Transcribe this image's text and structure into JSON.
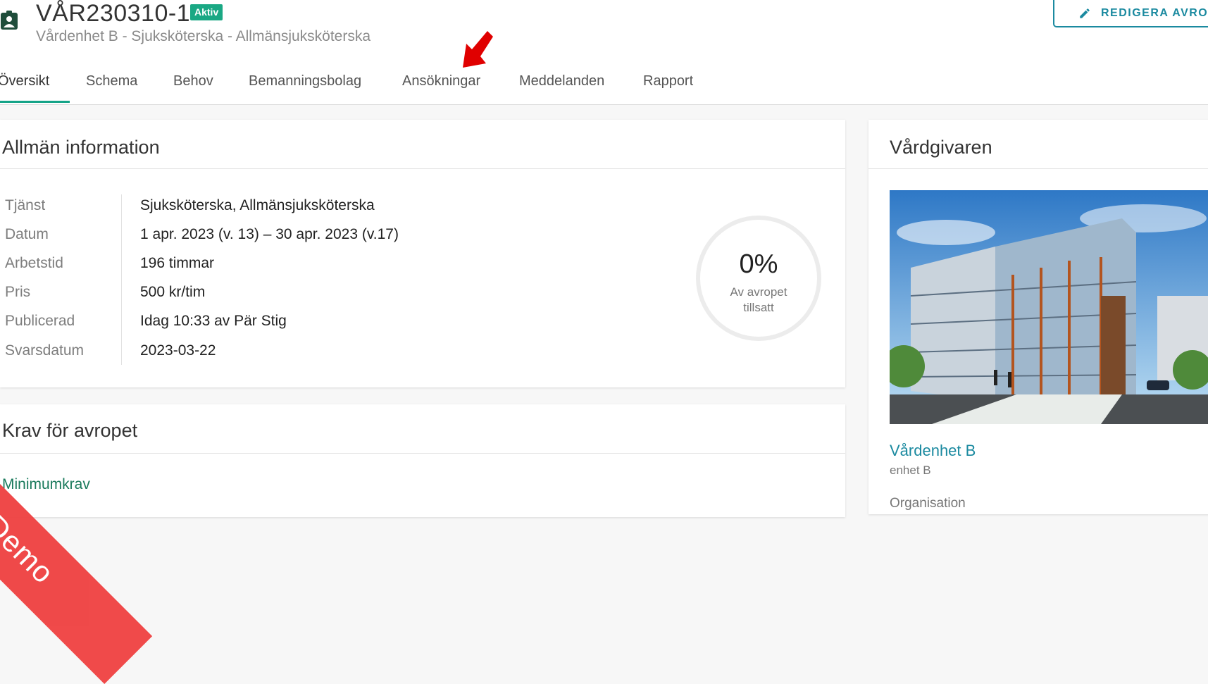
{
  "header": {
    "title": "VÅR230310-1",
    "status_badge": "Aktiv",
    "subtitle": "Vårdenhet B - Sjuksköterska - Allmänsjuksköterska",
    "edit_button_label": "REDIGERA AVRO"
  },
  "tabs": [
    {
      "label": "Översikt",
      "active": true
    },
    {
      "label": "Schema"
    },
    {
      "label": "Behov"
    },
    {
      "label": "Bemanningsbolag"
    },
    {
      "label": "Ansökningar"
    },
    {
      "label": "Meddelanden"
    },
    {
      "label": "Rapport"
    }
  ],
  "general_info": {
    "title": "Allmän information",
    "rows": [
      {
        "label": "Tjänst",
        "value": "Sjuksköterska, Allmänsjuksköterska"
      },
      {
        "label": "Datum",
        "value": "1 apr. 2023 (v. 13) – 30 apr. 2023 (v.17)"
      },
      {
        "label": "Arbetstid",
        "value": "196 timmar"
      },
      {
        "label": "Pris",
        "value": "500 kr/tim"
      },
      {
        "label": "Publicerad",
        "value": "Idag 10:33 av Pär Stig"
      },
      {
        "label": "Svarsdatum",
        "value": "2023-03-22"
      }
    ],
    "progress": {
      "value": "0%",
      "fraction": 0,
      "label_line1": "Av avropet",
      "label_line2": "tillsatt"
    }
  },
  "requirements": {
    "title": "Krav för avropet",
    "subtitle": "Minimumkrav"
  },
  "care_provider": {
    "title": "Vårdgivaren",
    "unit_link": "Vårdenhet B",
    "unit_sub": "enhet B",
    "org_label": "Organisation"
  },
  "demo_ribbon": "Demo",
  "colors": {
    "accent": "#14a387",
    "link": "#1b8aa0",
    "badge": "#1aa884",
    "arrow": "#e00000",
    "ribbon": "#ef4444"
  }
}
